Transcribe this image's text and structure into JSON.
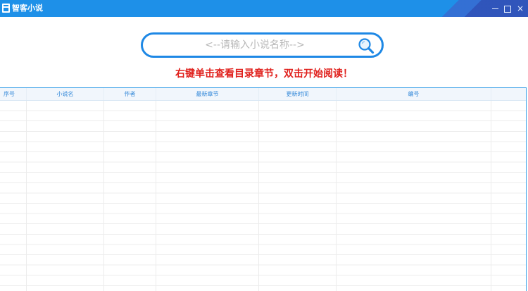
{
  "window": {
    "title": "智客小说",
    "controls": {
      "minimize": "",
      "maximize": "",
      "close": "×"
    }
  },
  "search": {
    "placeholder": "<--请输入小说名称-->",
    "value": ""
  },
  "hint": "右键单击查看目录章节，双击开始阅读！",
  "table": {
    "columns": [
      "序号",
      "小说名",
      "作者",
      "最新章节",
      "更新时间",
      "编号"
    ],
    "rows": []
  },
  "colors": {
    "titlebar": "#1e90e8",
    "accent": "#1e88e5",
    "hint": "#e0201c",
    "header_text": "#2f86d8"
  },
  "icons": {
    "app": "book-icon",
    "search": "magnifier-icon"
  }
}
